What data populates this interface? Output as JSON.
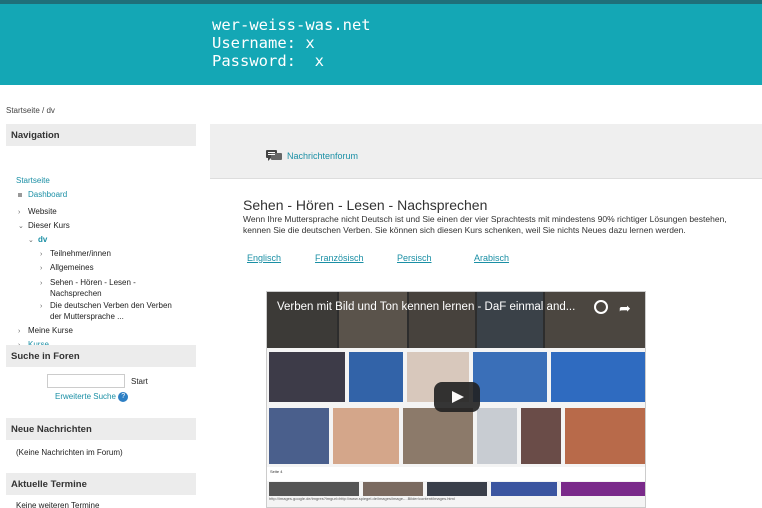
{
  "header": {
    "site": "wer-weiss-was.net",
    "username_line": "Username: x",
    "password_line": "Password:  x"
  },
  "breadcrumb": "Startseite / dv",
  "navigation": {
    "title": "Navigation",
    "home": "Startseite",
    "dashboard": "Dashboard",
    "website": "Website",
    "this_course": "Dieser Kurs",
    "dv": "dv",
    "participants": "Teilnehmer/innen",
    "general": "Allgemeines",
    "section1_line1": "Sehen - Hören - Lesen -",
    "section1_line2": "Nachsprechen",
    "section2_line1": "Die deutschen Verben den Verben",
    "section2_line2": "der Muttersprache ...",
    "my_courses": "Meine Kurse",
    "courses": "Kurse"
  },
  "forum_search": {
    "title": "Suche in Foren",
    "input_value": "",
    "button": "Start",
    "advanced": "Erweiterte Suche",
    "help_icon": "?"
  },
  "news": {
    "title": "Neue Nachrichten",
    "empty": "(Keine Nachrichten im Forum)"
  },
  "events": {
    "title": "Aktuelle Termine",
    "empty": "Keine weiteren Termine"
  },
  "main": {
    "forum_link": "Nachrichtenforum",
    "course_title": "Sehen - Hören - Lesen - Nachsprechen",
    "course_desc": "Wenn Ihre Muttersprache nicht Deutsch ist und Sie einen der vier Sprachtests mit mindestens 90% richtiger Lösungen bestehen, kennen Sie die deutschen Verben. Sie können sich diesen Kurs schenken, weil Sie nichts Neues dazu lernen werden.",
    "languages": [
      "Englisch",
      "Französisch",
      "Persisch",
      "Arabisch"
    ]
  },
  "video": {
    "title": "Verben mit Bild und Ton kennen lernen - DaF einmal and...",
    "clock_icon": "watch-later-icon",
    "share_icon": "share-icon",
    "play_icon": "play-icon",
    "strip_label": "Seite 4",
    "caption": "http://images.google.de/imgres?imgurl=http://www.spiegel.de/images/image-...Bilder/content/images.html"
  },
  "colors": {
    "header_bg": "#14a7b5",
    "link": "#1a8fa5",
    "panel_bg": "#efefef"
  }
}
